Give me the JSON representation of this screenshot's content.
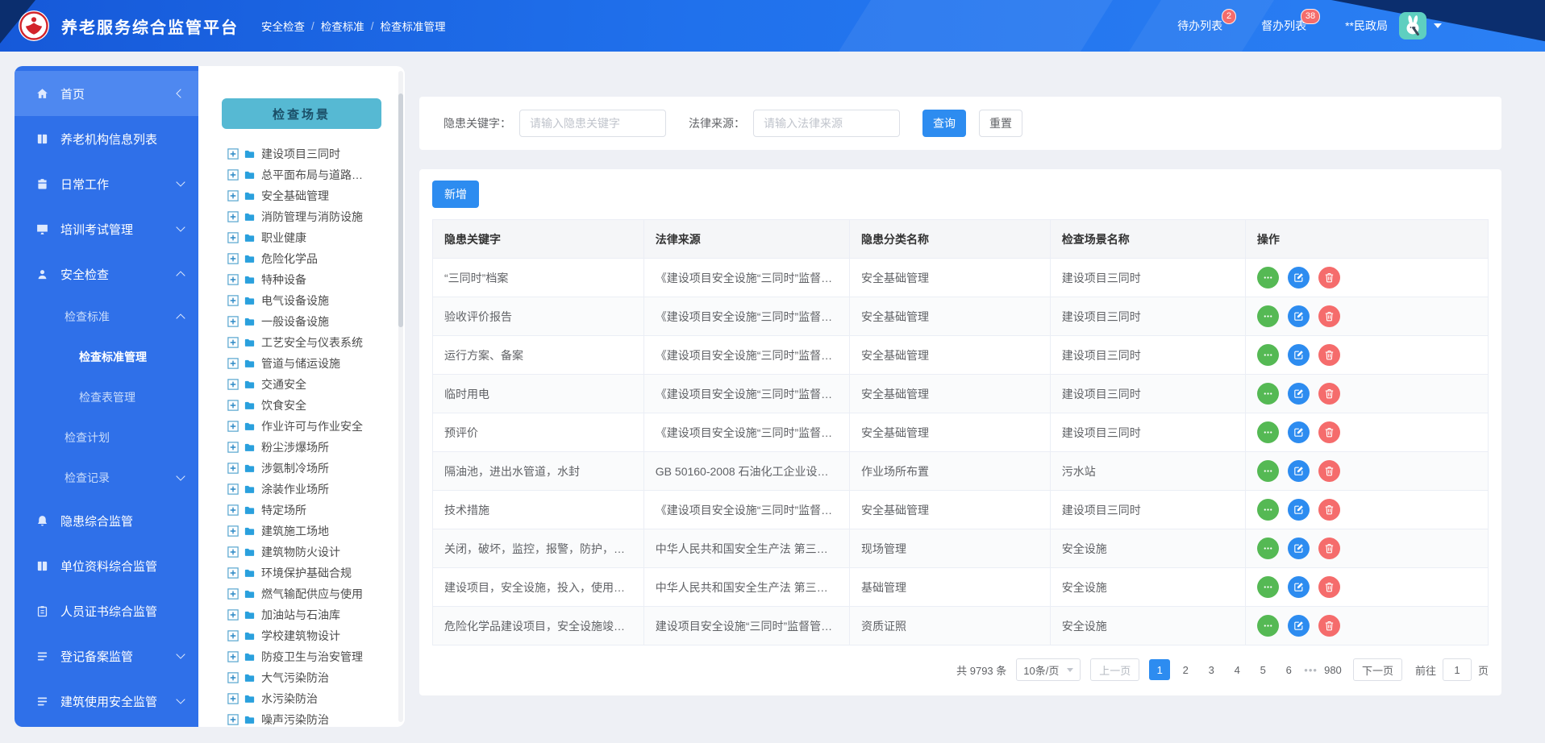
{
  "colors": {
    "accent": "#2d8cf0",
    "success": "#55b954",
    "danger": "#f56c6c",
    "sidebar_blue": "#2f70e9",
    "scene_teal": "#56b9d3",
    "badge_red": "#f56c6c",
    "header_navy": "#0b2e6e"
  },
  "header": {
    "app_title": "养老服务综合监管平台",
    "breadcrumb": [
      "安全检查",
      "检查标准",
      "检查标准管理"
    ],
    "nav": [
      {
        "label": "待办列表",
        "badge": "2"
      },
      {
        "label": "督办列表",
        "badge": "38"
      }
    ],
    "user_name": "**民政局"
  },
  "sidebar": {
    "items": [
      {
        "label": "首页",
        "icon": "home",
        "level": 0,
        "active": true,
        "collapse": true
      },
      {
        "label": "养老机构信息列表",
        "icon": "book",
        "level": 0
      },
      {
        "label": "日常工作",
        "icon": "briefcase",
        "level": 0,
        "arrow": "down"
      },
      {
        "label": "培训考试管理",
        "icon": "monitor",
        "level": 0,
        "arrow": "down"
      },
      {
        "label": "安全检查",
        "icon": "user",
        "level": 0,
        "arrow": "up"
      },
      {
        "label": "检查标准",
        "level": 1,
        "arrow": "up"
      },
      {
        "label": "检查标准管理",
        "level": 2,
        "active": true
      },
      {
        "label": "检查表管理",
        "level": 2
      },
      {
        "label": "检查计划",
        "level": 1
      },
      {
        "label": "检查记录",
        "level": 1,
        "arrow": "down"
      },
      {
        "label": "隐患综合监管",
        "icon": "bell",
        "level": 0
      },
      {
        "label": "单位资料综合监管",
        "icon": "book",
        "level": 0
      },
      {
        "label": "人员证书综合监管",
        "icon": "clipboard",
        "level": 0
      },
      {
        "label": "登记备案监管",
        "icon": "list",
        "level": 0,
        "arrow": "down"
      },
      {
        "label": "建筑使用安全监管",
        "icon": "list",
        "level": 0,
        "arrow": "down"
      }
    ]
  },
  "tree": {
    "header_label": "检查场景",
    "items": [
      "建设项目三同时",
      "总平面布局与道路…",
      "安全基础管理",
      "消防管理与消防设施",
      "职业健康",
      "危险化学品",
      "特种设备",
      "电气设备设施",
      "一般设备设施",
      "工艺安全与仪表系统",
      "管道与储运设施",
      "交通安全",
      "饮食安全",
      "作业许可与作业安全",
      "粉尘涉爆场所",
      "涉氨制冷场所",
      "涂装作业场所",
      "特定场所",
      "建筑施工场地",
      "建筑物防火设计",
      "环境保护基础合规",
      "燃气输配供应与使用",
      "加油站与石油库",
      "学校建筑物设计",
      "防疫卫生与治安管理",
      "大气污染防治",
      "水污染防治",
      "噪声污染防治"
    ]
  },
  "search": {
    "keyword_label": "隐患关键字：",
    "keyword_placeholder": "请输入隐患关键字",
    "law_label": "法律来源：",
    "law_placeholder": "请输入法律来源",
    "query_label": "查询",
    "reset_label": "重置"
  },
  "toolbar": {
    "add_label": "新增"
  },
  "table": {
    "columns": [
      "隐患关键字",
      "法律来源",
      "隐患分类名称",
      "检查场景名称",
      "操作"
    ],
    "rows": [
      {
        "keyword": "“三同时”档案",
        "law": "《建设项目安全设施“三同时”监督…",
        "category": "安全基础管理",
        "scene": "建设项目三同时"
      },
      {
        "keyword": "验收评价报告",
        "law": "《建设项目安全设施“三同时”监督…",
        "category": "安全基础管理",
        "scene": "建设项目三同时"
      },
      {
        "keyword": "运行方案、备案",
        "law": "《建设项目安全设施“三同时”监督…",
        "category": "安全基础管理",
        "scene": "建设项目三同时"
      },
      {
        "keyword": "临时用电",
        "law": "《建设项目安全设施“三同时”监督…",
        "category": "安全基础管理",
        "scene": "建设项目三同时"
      },
      {
        "keyword": "预评价",
        "law": "《建设项目安全设施“三同时”监督…",
        "category": "安全基础管理",
        "scene": "建设项目三同时"
      },
      {
        "keyword": "隔油池，进出水管道，水封",
        "law": "GB 50160-2008 石油化工企业设计…",
        "category": "作业场所布置",
        "scene": "污水站"
      },
      {
        "keyword": "技术措施",
        "law": "《建设项目安全设施“三同时”监督…",
        "category": "安全基础管理",
        "scene": "建设项目三同时"
      },
      {
        "keyword": "关闭，破坏，监控，报警，防护，…",
        "law": "中华人民共和国安全生产法 第三十…",
        "category": "现场管理",
        "scene": "安全设施"
      },
      {
        "keyword": "建设项目，安全设施，投入，使用…",
        "law": "中华人民共和国安全生产法 第三十…",
        "category": "基础管理",
        "scene": "安全设施"
      },
      {
        "keyword": "危险化学品建设项目，安全设施竣…",
        "law": "建设项目安全设施“三同时”监督管…",
        "category": "资质证照",
        "scene": "安全设施"
      }
    ]
  },
  "pagination": {
    "total": "共 9793 条",
    "page_size": "10条/页",
    "prev": "上一页",
    "next": "下一页",
    "pages": [
      "1",
      "2",
      "3",
      "4",
      "5",
      "6"
    ],
    "dots": "•••",
    "last": "980",
    "active": "1",
    "goto_label": "前往",
    "goto_value": "1",
    "goto_unit": "页"
  }
}
